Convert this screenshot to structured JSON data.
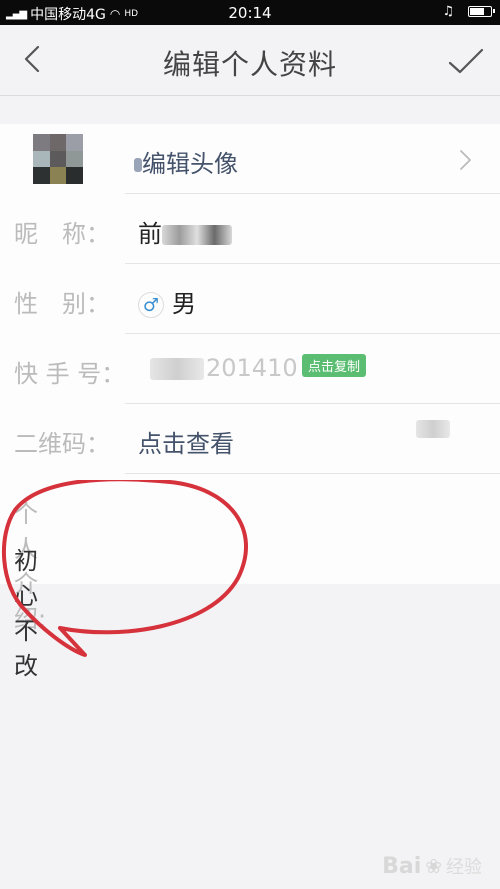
{
  "status_bar": {
    "signal": "4G",
    "carrier": "中国移动4G",
    "hd": "HD",
    "time": "20:14",
    "battery_level": 0.75
  },
  "header": {
    "title": "编辑个人资料",
    "back_icon": "chevron-left-icon",
    "confirm_icon": "check-icon"
  },
  "profile": {
    "avatar_label": "编辑头像",
    "nickname_label": "昵　称：",
    "nickname_value": "前",
    "gender_label": "性　别：",
    "gender_symbol": "♂",
    "gender_value": "男",
    "kuaishou_label": "快 手 号：",
    "kuaishou_value": "201410",
    "copy_button": "点击复制",
    "qrcode_label": "二维码：",
    "qrcode_value": "点击查看",
    "bio_label": "个人介绍:",
    "bio_value": "初心不改"
  },
  "colors": {
    "copy_button": "#5bbd72",
    "annotation": "#d6323c",
    "link": "#44526b"
  },
  "watermark": {
    "brand": "Bai",
    "suffix": "经验"
  }
}
